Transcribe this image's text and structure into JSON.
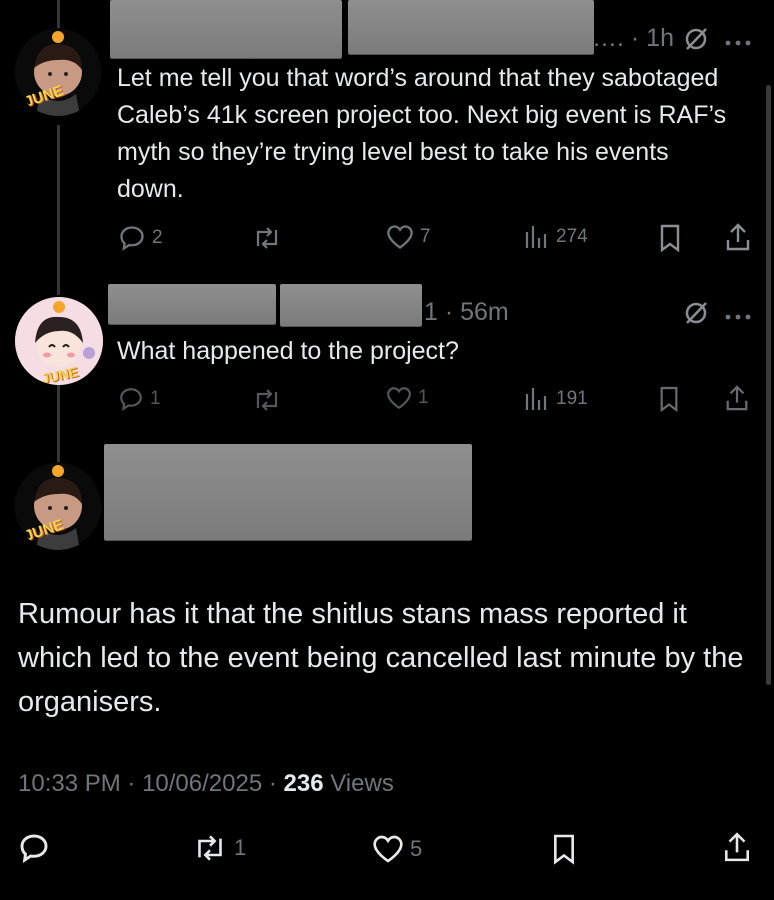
{
  "tweet1": {
    "time_suffix": "…. · 1h",
    "text": "Let me tell you that word’s around that they sabotaged Caleb’s 41k screen project too. Next big event is RAF’s myth so they’re trying level best to take his events down.",
    "replies": "2",
    "reposts": "",
    "likes": "7",
    "views": "274",
    "avatar_label": "JUNE"
  },
  "tweet2": {
    "time_suffix": "1 · 56m",
    "text": "What happened to the project?",
    "replies": "1",
    "reposts": "",
    "likes": "1",
    "views": "191",
    "avatar_label": "JUNE"
  },
  "main_tweet": {
    "avatar_label": "JUNE",
    "text": "Rumour has it that the shitlus stans mass reported it which led to the event being cancelled last minute by the organisers.",
    "time": "10:33 PM",
    "date": "10/06/2025",
    "views_count": "236",
    "views_label": "Views",
    "reposts": "1",
    "likes": "5"
  },
  "colors": {
    "background": "#000000",
    "text": "#e7e9ea",
    "muted": "#71767b"
  }
}
